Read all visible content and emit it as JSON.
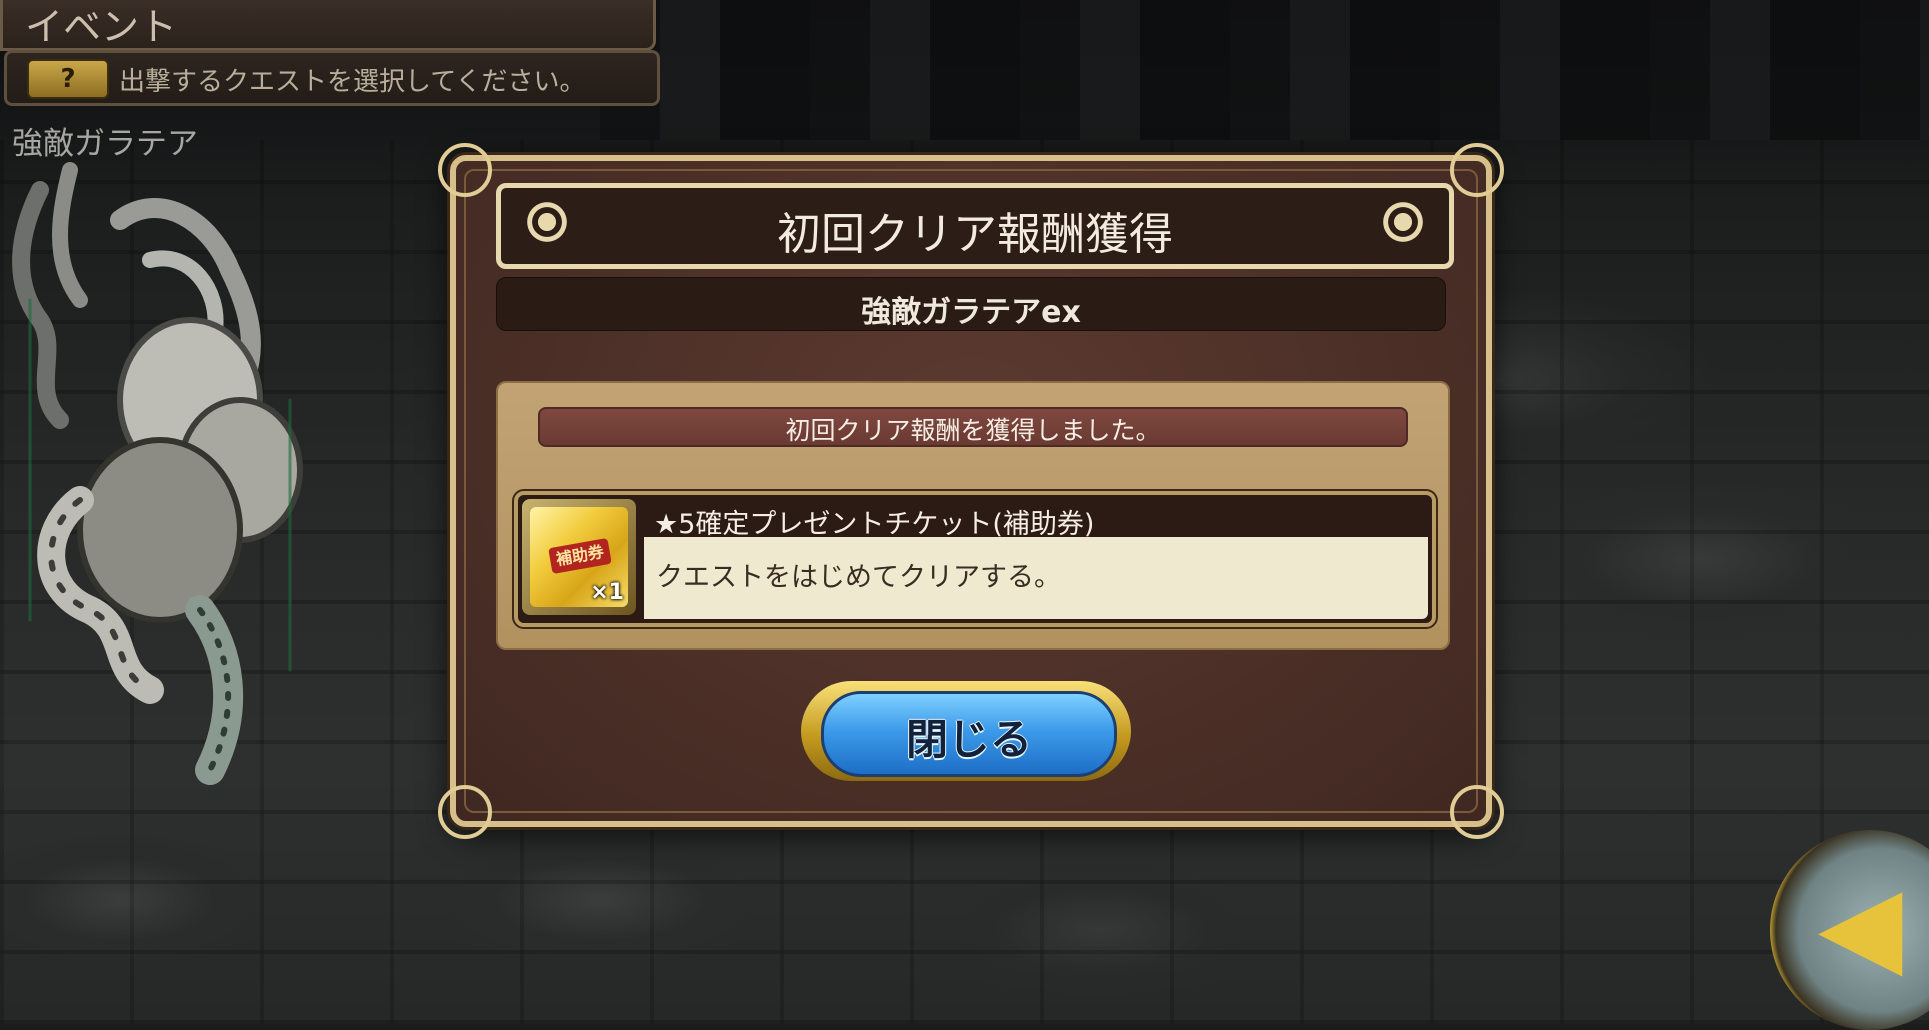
{
  "header": {
    "title": "イベント"
  },
  "hint": {
    "button_label": "?",
    "text": "出撃するクエストを選択してください。"
  },
  "boss": {
    "name": "強敵ガラテア"
  },
  "dialog": {
    "title": "初回クリア報酬獲得",
    "quest_name": "強敵ガラテアex",
    "notice": "初回クリア報酬を獲得しました。",
    "reward": {
      "icon_label": "補助券",
      "quantity": "×1",
      "name": "★5確定プレゼントチケット(補助券)",
      "condition": "クエストをはじめてクリアする。"
    },
    "close_label": "閉じる"
  },
  "nav": {
    "back_icon": "back-arrow-icon"
  },
  "colors": {
    "dialog_bg": "#4b2f27",
    "dialog_border": "#d6bf8a",
    "close_button": "#3d9bea",
    "ticket": "#f2cd3e"
  }
}
